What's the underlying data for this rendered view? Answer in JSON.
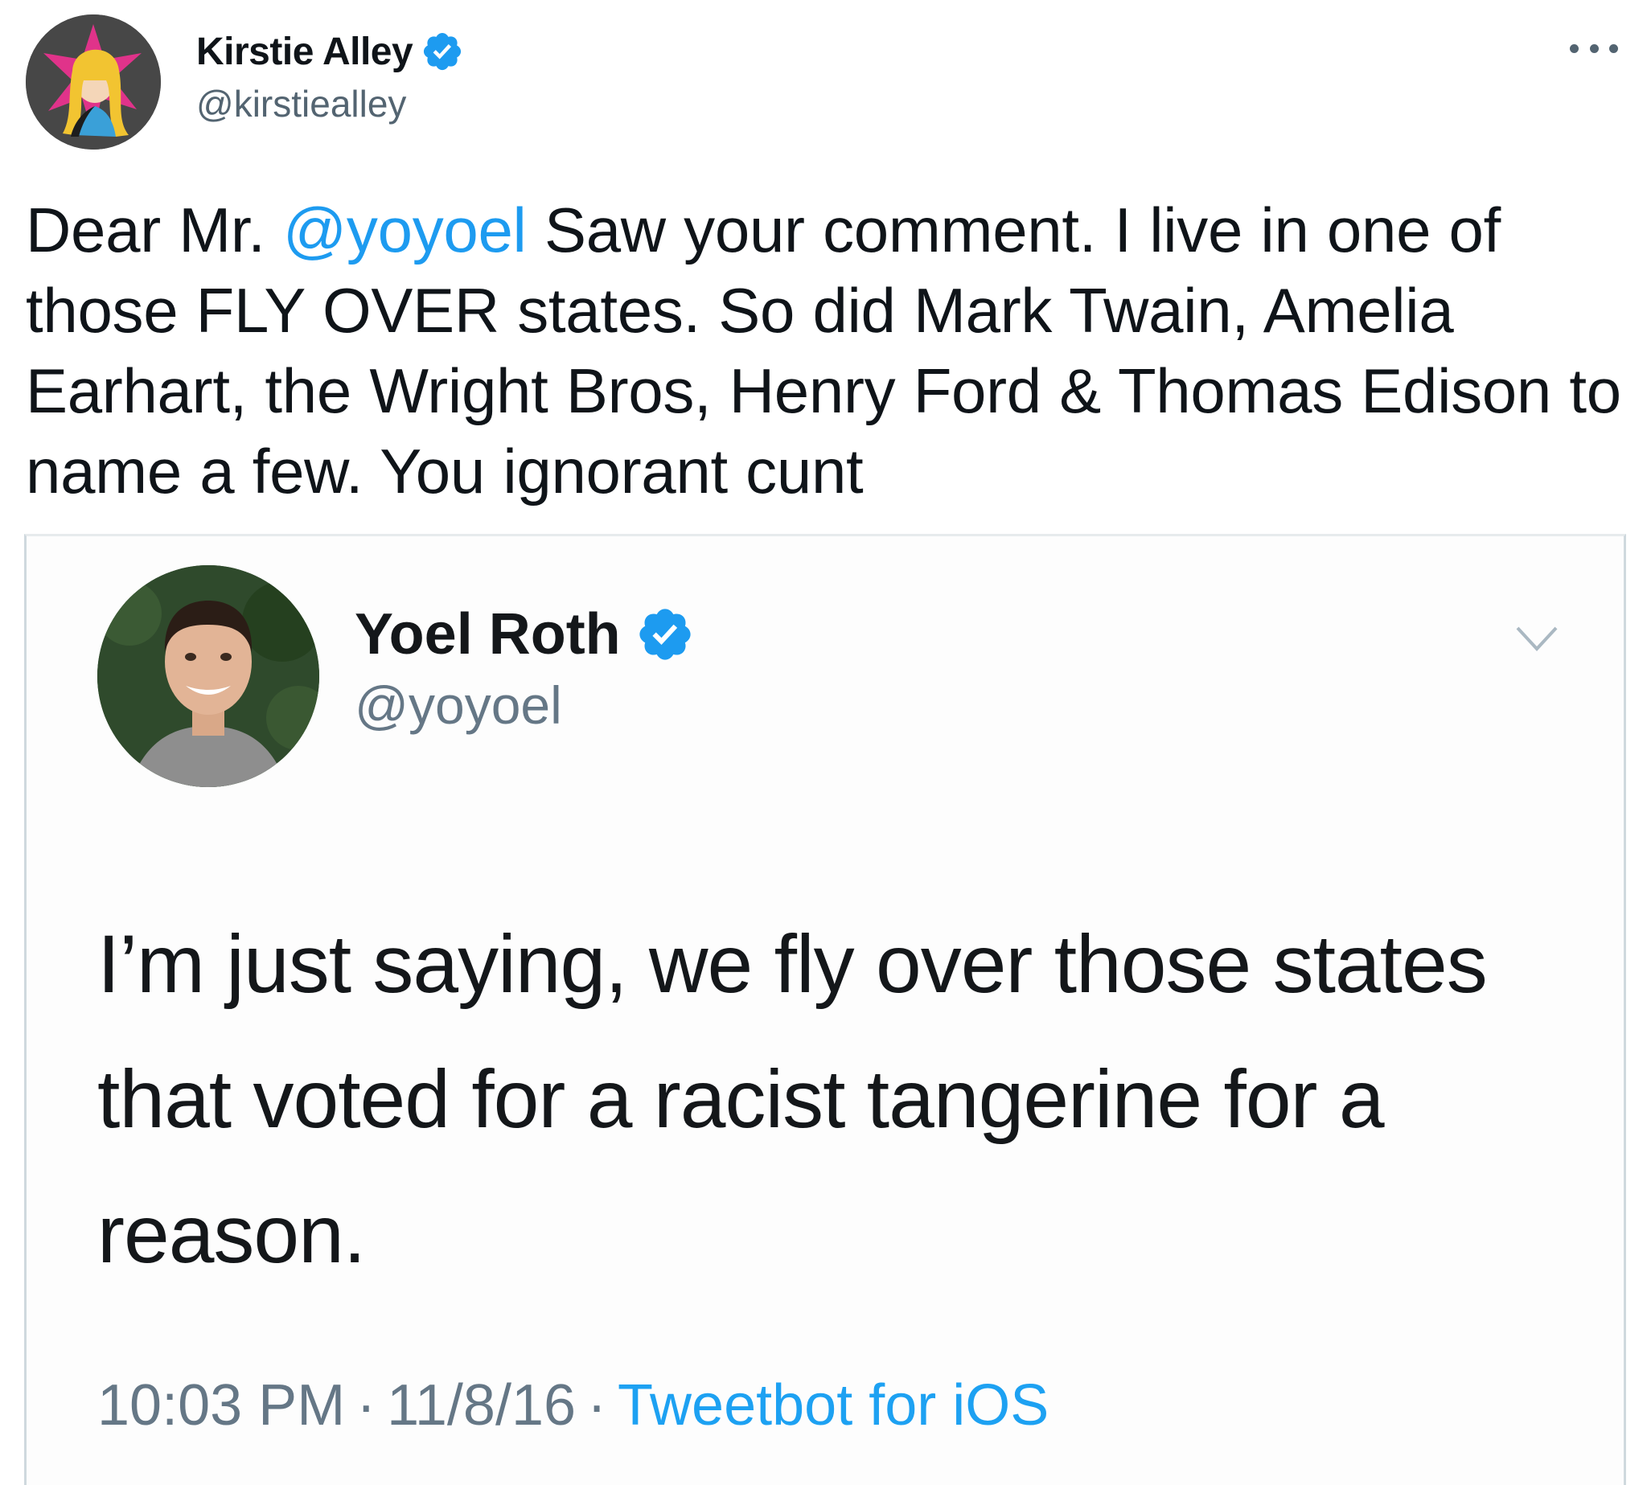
{
  "tweet": {
    "author_name": "Kirstie Alley",
    "author_handle": "@kirstiealley",
    "text_before": "Dear Mr. ",
    "mention": "@yoyoel",
    "text_after": " Saw your comment. I live in one of those FLY OVER states. So did Mark Twain, Amelia Earhart, the Wright Bros, Henry Ford & Thomas Edison to name a few. You ignorant cunt"
  },
  "quoted": {
    "author_name": "Yoel Roth",
    "author_handle": "@yoyoel",
    "text": "I’m just saying, we fly over those states that voted for a racist tangerine for a reason.",
    "time": "10:03 PM",
    "separator": "·",
    "date": "11/8/16",
    "client": "Tweetbot for iOS"
  },
  "icons": {
    "verified": "verified-badge-icon",
    "more": "more-options-icon",
    "chevron": "chevron-down-icon"
  },
  "colors": {
    "link_blue": "#1d9bf0",
    "verified_blue": "#1d9bf0",
    "secondary_text": "#536471"
  }
}
